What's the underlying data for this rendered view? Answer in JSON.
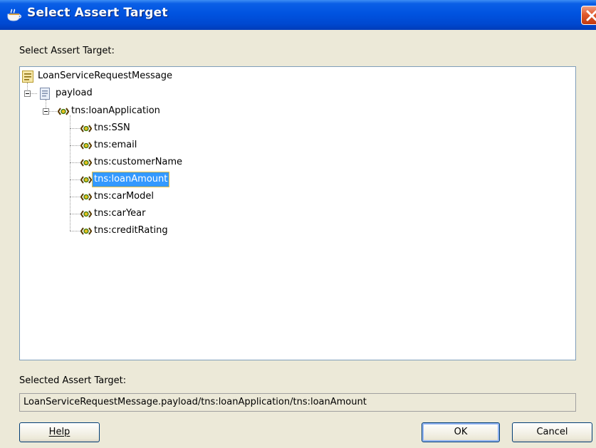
{
  "window": {
    "title": "Select Assert Target",
    "accent": "#0054e3",
    "close_color": "#e05a2c"
  },
  "prompt_label": "Select Assert Target:",
  "tree": {
    "root": {
      "label": "LoanServiceRequestMessage",
      "icon": "message-icon"
    },
    "payload": {
      "label": "payload",
      "icon": "document-icon",
      "expanded": true
    },
    "loanApplication": {
      "label": "tns:loanApplication",
      "icon": "element-icon",
      "expanded": true
    },
    "children": [
      {
        "label": "tns:SSN",
        "icon": "element-icon"
      },
      {
        "label": "tns:email",
        "icon": "element-icon"
      },
      {
        "label": "tns:customerName",
        "icon": "element-icon"
      },
      {
        "label": "tns:loanAmount",
        "icon": "element-icon",
        "selected": true
      },
      {
        "label": "tns:carModel",
        "icon": "element-icon"
      },
      {
        "label": "tns:carYear",
        "icon": "element-icon"
      },
      {
        "label": "tns:creditRating",
        "icon": "element-icon"
      }
    ]
  },
  "selected_label": "Selected Assert Target:",
  "selected_value": "LoanServiceRequestMessage.payload/tns:loanApplication/tns:loanAmount",
  "buttons": {
    "help": "Help",
    "ok": "OK",
    "cancel": "Cancel"
  }
}
